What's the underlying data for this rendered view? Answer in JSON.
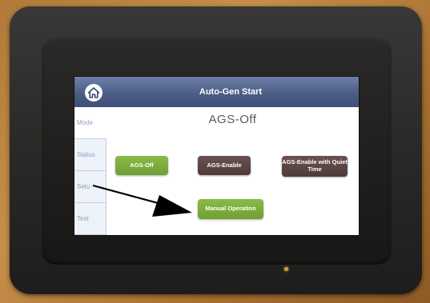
{
  "header": {
    "title": "Auto-Gen Start",
    "home_icon": "home-icon"
  },
  "sidebar": {
    "items": [
      {
        "label": "Mode"
      },
      {
        "label": "Status"
      },
      {
        "label": "Setu"
      },
      {
        "label": "Test"
      }
    ]
  },
  "main": {
    "heading": "AGS-Off",
    "buttons": {
      "ags_off": "AGS-Off",
      "ags_enable": "AGS-Enable",
      "ags_enable_quiet": "AGS-Enable with Quiet Time",
      "manual_operation": "Manual Operation"
    }
  },
  "colors": {
    "titlebar": "#4c5d86",
    "selected_button": "#6f9e33",
    "unselected_button": "#4e3a3a"
  }
}
